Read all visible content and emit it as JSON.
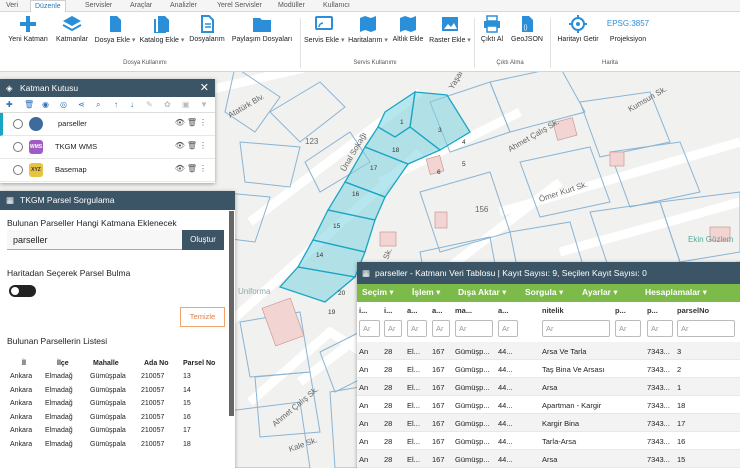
{
  "tabs": [
    "Veri",
    "Düzenle",
    "Servisler",
    "Araçlar",
    "Analizler",
    "Yerel Servisler",
    "Modüller",
    "Kullanıcı"
  ],
  "ribbon": {
    "buttons": [
      "Yeni Katman",
      "Katmanlar",
      "Dosya Ekle",
      "Katalog Ekle",
      "Dosyalarım",
      "Paylaşım Dosyaları",
      "Servis Ekle",
      "Haritalarım",
      "Altlık Ekle",
      "Raster Ekle",
      "Çıktı Al",
      "GeoJSON",
      "Haritayı Getir",
      "Projeksiyon"
    ],
    "groups": [
      "Dosya Kullanımı",
      "Servis Kullanımı",
      "Çıktı Alma",
      "Harita"
    ],
    "epsg": "EPSG:3857"
  },
  "map_labels": {
    "ataturk": "Atatürk Blv.",
    "unal": "Ünal Sokağı",
    "yasar": "Yaşar Sk.",
    "kumsun": "Kumsun Sk.",
    "ahmet1": "Ahmet Çalış Sk.",
    "ahmet2": "Ahmet Çalış Sk.",
    "omer": "Ömer Kurt Sk.",
    "uniforma": "Uniforma",
    "ekin": "Ekin Gözlem",
    "kale": "Kale Sk.",
    "n123": "123",
    "n156": "156",
    "sk": "Sk.",
    "parcels": [
      "1",
      "3",
      "18",
      "6",
      "17",
      "16",
      "15",
      "14",
      "20",
      "19",
      "4",
      "5"
    ]
  },
  "layers": {
    "title": "Katman Kutusu",
    "items": [
      {
        "name": "parseller",
        "icon": ""
      },
      {
        "name": "TKGM WMS",
        "icon": "WMS"
      },
      {
        "name": "Basemap",
        "icon": "XYZ"
      }
    ]
  },
  "tkgm": {
    "title": "TKGM Parsel Sorgulama",
    "add_label": "Bulunan Parseller Hangi Katmana Eklenecek",
    "layer_value": "parseller",
    "create_btn": "Oluştur",
    "select_label": "Haritadan Seçerek Parsel Bulma",
    "clear_btn": "Temizle",
    "list_title": "Bulunan Parsellerin Listesi",
    "headers": [
      "İl",
      "İlçe",
      "Mahalle",
      "Ada No",
      "Parsel No"
    ],
    "rows": [
      [
        "Ankara",
        "Elmadağ",
        "Gümüşpala",
        "210057",
        "13"
      ],
      [
        "Ankara",
        "Elmadağ",
        "Gümüşpala",
        "210057",
        "14"
      ],
      [
        "Ankara",
        "Elmadağ",
        "Gümüşpala",
        "210057",
        "15"
      ],
      [
        "Ankara",
        "Elmadağ",
        "Gümüşpala",
        "210057",
        "16"
      ],
      [
        "Ankara",
        "Elmadağ",
        "Gümüşpala",
        "210057",
        "17"
      ],
      [
        "Ankara",
        "Elmadağ",
        "Gümüşpala",
        "210057",
        "18"
      ]
    ]
  },
  "table": {
    "title": "parseller - Katmanı Veri Tablosu | Kayıt Sayısı: 9, Seçilen Kayıt Sayısı: 0",
    "menu": [
      "Seçim",
      "İşlem",
      "Dışa Aktar",
      "Sorgula",
      "Ayarlar",
      "Hesaplamalar"
    ],
    "headers": [
      "i...",
      "i...",
      "a...",
      "a...",
      "ma...",
      "a...",
      "nitelik",
      "p...",
      "p...",
      "parselNo"
    ],
    "filter_placeholder": "Ar",
    "rows": [
      [
        "An",
        "28",
        "El...",
        "167",
        "Gümüşp...",
        "44...",
        "Arsa Ve Tarla",
        "",
        "7343...",
        "3"
      ],
      [
        "An",
        "28",
        "El...",
        "167",
        "Gümüşp...",
        "44...",
        "Taş Bina Ve Arsası",
        "",
        "7343...",
        "2"
      ],
      [
        "An",
        "28",
        "El...",
        "167",
        "Gümüşp...",
        "44...",
        "Arsa",
        "",
        "7343...",
        "1"
      ],
      [
        "An",
        "28",
        "El...",
        "167",
        "Gümüşp...",
        "44...",
        "Apartman - Kargir",
        "",
        "7343...",
        "18"
      ],
      [
        "An",
        "28",
        "El...",
        "167",
        "Gümüşp...",
        "44...",
        "Kargir Bina",
        "",
        "7343...",
        "17"
      ],
      [
        "An",
        "28",
        "El...",
        "167",
        "Gümüşp...",
        "44...",
        "Tarla-Arsa",
        "",
        "7343...",
        "16"
      ],
      [
        "An",
        "28",
        "El...",
        "167",
        "Gümüşp...",
        "44...",
        "Arsa",
        "",
        "7343...",
        "15"
      ]
    ]
  }
}
